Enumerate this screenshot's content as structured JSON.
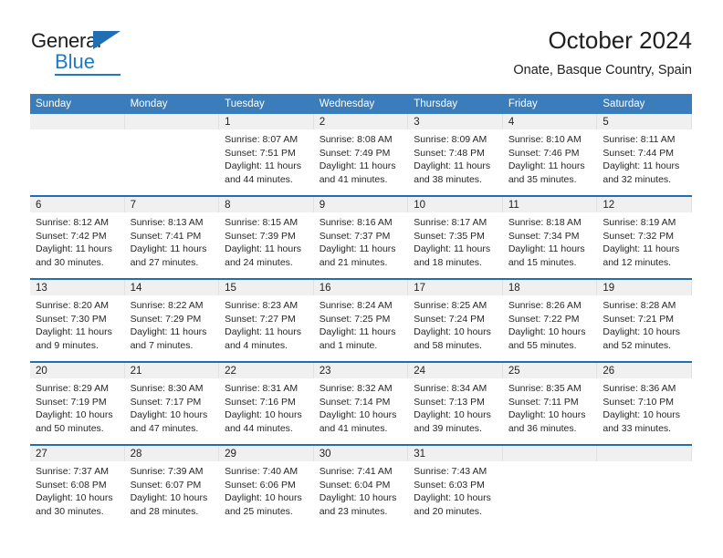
{
  "brand": {
    "name_top": "General",
    "name_bottom": "Blue",
    "accent_color": "#1f7bc1"
  },
  "header": {
    "title": "October 2024",
    "subtitle": "Onate, Basque Country, Spain"
  },
  "theme": {
    "header_blue": "#3b7cba",
    "rule_blue": "#1f6fb2",
    "daynum_band": "#f0f0f0"
  },
  "weekdays": [
    "Sunday",
    "Monday",
    "Tuesday",
    "Wednesday",
    "Thursday",
    "Friday",
    "Saturday"
  ],
  "weeks": [
    [
      {
        "day": "",
        "lines": []
      },
      {
        "day": "",
        "lines": []
      },
      {
        "day": "1",
        "lines": [
          "Sunrise: 8:07 AM",
          "Sunset: 7:51 PM",
          "Daylight: 11 hours",
          "and 44 minutes."
        ]
      },
      {
        "day": "2",
        "lines": [
          "Sunrise: 8:08 AM",
          "Sunset: 7:49 PM",
          "Daylight: 11 hours",
          "and 41 minutes."
        ]
      },
      {
        "day": "3",
        "lines": [
          "Sunrise: 8:09 AM",
          "Sunset: 7:48 PM",
          "Daylight: 11 hours",
          "and 38 minutes."
        ]
      },
      {
        "day": "4",
        "lines": [
          "Sunrise: 8:10 AM",
          "Sunset: 7:46 PM",
          "Daylight: 11 hours",
          "and 35 minutes."
        ]
      },
      {
        "day": "5",
        "lines": [
          "Sunrise: 8:11 AM",
          "Sunset: 7:44 PM",
          "Daylight: 11 hours",
          "and 32 minutes."
        ]
      }
    ],
    [
      {
        "day": "6",
        "lines": [
          "Sunrise: 8:12 AM",
          "Sunset: 7:42 PM",
          "Daylight: 11 hours",
          "and 30 minutes."
        ]
      },
      {
        "day": "7",
        "lines": [
          "Sunrise: 8:13 AM",
          "Sunset: 7:41 PM",
          "Daylight: 11 hours",
          "and 27 minutes."
        ]
      },
      {
        "day": "8",
        "lines": [
          "Sunrise: 8:15 AM",
          "Sunset: 7:39 PM",
          "Daylight: 11 hours",
          "and 24 minutes."
        ]
      },
      {
        "day": "9",
        "lines": [
          "Sunrise: 8:16 AM",
          "Sunset: 7:37 PM",
          "Daylight: 11 hours",
          "and 21 minutes."
        ]
      },
      {
        "day": "10",
        "lines": [
          "Sunrise: 8:17 AM",
          "Sunset: 7:35 PM",
          "Daylight: 11 hours",
          "and 18 minutes."
        ]
      },
      {
        "day": "11",
        "lines": [
          "Sunrise: 8:18 AM",
          "Sunset: 7:34 PM",
          "Daylight: 11 hours",
          "and 15 minutes."
        ]
      },
      {
        "day": "12",
        "lines": [
          "Sunrise: 8:19 AM",
          "Sunset: 7:32 PM",
          "Daylight: 11 hours",
          "and 12 minutes."
        ]
      }
    ],
    [
      {
        "day": "13",
        "lines": [
          "Sunrise: 8:20 AM",
          "Sunset: 7:30 PM",
          "Daylight: 11 hours",
          "and 9 minutes."
        ]
      },
      {
        "day": "14",
        "lines": [
          "Sunrise: 8:22 AM",
          "Sunset: 7:29 PM",
          "Daylight: 11 hours",
          "and 7 minutes."
        ]
      },
      {
        "day": "15",
        "lines": [
          "Sunrise: 8:23 AM",
          "Sunset: 7:27 PM",
          "Daylight: 11 hours",
          "and 4 minutes."
        ]
      },
      {
        "day": "16",
        "lines": [
          "Sunrise: 8:24 AM",
          "Sunset: 7:25 PM",
          "Daylight: 11 hours",
          "and 1 minute."
        ]
      },
      {
        "day": "17",
        "lines": [
          "Sunrise: 8:25 AM",
          "Sunset: 7:24 PM",
          "Daylight: 10 hours",
          "and 58 minutes."
        ]
      },
      {
        "day": "18",
        "lines": [
          "Sunrise: 8:26 AM",
          "Sunset: 7:22 PM",
          "Daylight: 10 hours",
          "and 55 minutes."
        ]
      },
      {
        "day": "19",
        "lines": [
          "Sunrise: 8:28 AM",
          "Sunset: 7:21 PM",
          "Daylight: 10 hours",
          "and 52 minutes."
        ]
      }
    ],
    [
      {
        "day": "20",
        "lines": [
          "Sunrise: 8:29 AM",
          "Sunset: 7:19 PM",
          "Daylight: 10 hours",
          "and 50 minutes."
        ]
      },
      {
        "day": "21",
        "lines": [
          "Sunrise: 8:30 AM",
          "Sunset: 7:17 PM",
          "Daylight: 10 hours",
          "and 47 minutes."
        ]
      },
      {
        "day": "22",
        "lines": [
          "Sunrise: 8:31 AM",
          "Sunset: 7:16 PM",
          "Daylight: 10 hours",
          "and 44 minutes."
        ]
      },
      {
        "day": "23",
        "lines": [
          "Sunrise: 8:32 AM",
          "Sunset: 7:14 PM",
          "Daylight: 10 hours",
          "and 41 minutes."
        ]
      },
      {
        "day": "24",
        "lines": [
          "Sunrise: 8:34 AM",
          "Sunset: 7:13 PM",
          "Daylight: 10 hours",
          "and 39 minutes."
        ]
      },
      {
        "day": "25",
        "lines": [
          "Sunrise: 8:35 AM",
          "Sunset: 7:11 PM",
          "Daylight: 10 hours",
          "and 36 minutes."
        ]
      },
      {
        "day": "26",
        "lines": [
          "Sunrise: 8:36 AM",
          "Sunset: 7:10 PM",
          "Daylight: 10 hours",
          "and 33 minutes."
        ]
      }
    ],
    [
      {
        "day": "27",
        "lines": [
          "Sunrise: 7:37 AM",
          "Sunset: 6:08 PM",
          "Daylight: 10 hours",
          "and 30 minutes."
        ]
      },
      {
        "day": "28",
        "lines": [
          "Sunrise: 7:39 AM",
          "Sunset: 6:07 PM",
          "Daylight: 10 hours",
          "and 28 minutes."
        ]
      },
      {
        "day": "29",
        "lines": [
          "Sunrise: 7:40 AM",
          "Sunset: 6:06 PM",
          "Daylight: 10 hours",
          "and 25 minutes."
        ]
      },
      {
        "day": "30",
        "lines": [
          "Sunrise: 7:41 AM",
          "Sunset: 6:04 PM",
          "Daylight: 10 hours",
          "and 23 minutes."
        ]
      },
      {
        "day": "31",
        "lines": [
          "Sunrise: 7:43 AM",
          "Sunset: 6:03 PM",
          "Daylight: 10 hours",
          "and 20 minutes."
        ]
      },
      {
        "day": "",
        "lines": []
      },
      {
        "day": "",
        "lines": []
      }
    ]
  ]
}
